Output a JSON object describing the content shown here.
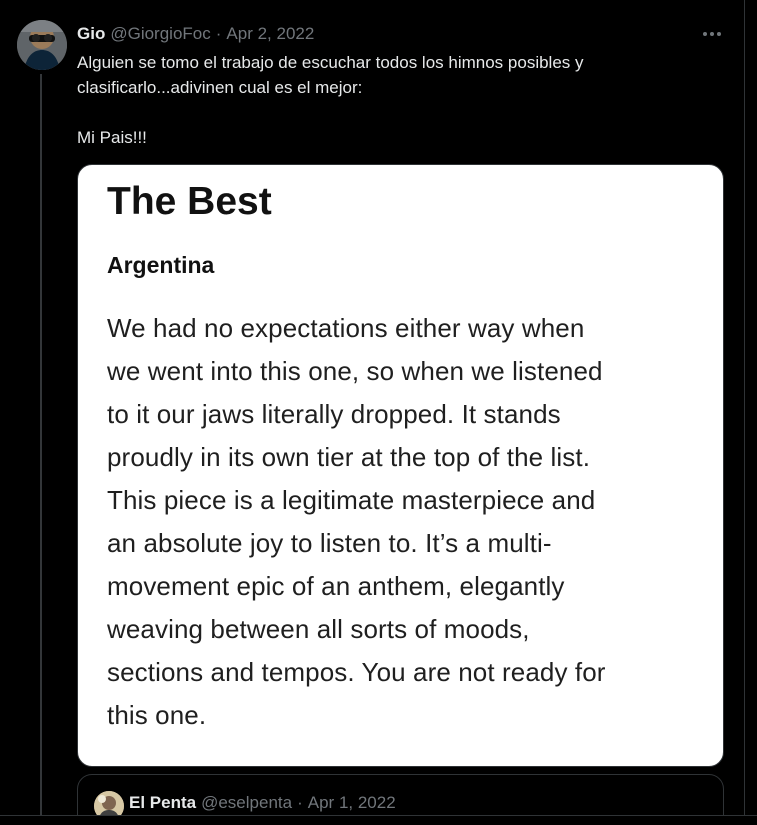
{
  "tweet": {
    "author_name": "Gio",
    "author_handle": "@GiorgioFoc",
    "separator": "·",
    "date": "Apr 2, 2022",
    "more_icon": "more-horizontal-icon",
    "text_line_1": "Alguien se tomo el trabajo de escuchar todos los himnos posibles y",
    "text_line_2": "clasificarlo...adivinen cual es el mejor:",
    "text_line_3": "Mi Pais!!!"
  },
  "media": {
    "title": "The Best",
    "subtitle": "Argentina",
    "body_lines": [
      "We had no expectations either way when",
      "we went into this one, so when we listened",
      "to it our jaws literally dropped. It stands",
      "proudly in its own tier at the top of the list.",
      "This piece is a legitimate masterpiece and",
      "an absolute joy to listen to. It’s a multi-",
      "movement epic of an anthem, elegantly",
      "weaving between all sorts of moods,",
      "sections and tempos. You are not ready for",
      "this one."
    ]
  },
  "quoted_tweet": {
    "author_name": "El Penta",
    "author_handle": "@eselpenta",
    "separator": "·",
    "date": "Apr 1, 2022"
  },
  "colors": {
    "background": "#000000",
    "primary_text": "#e7e9ea",
    "secondary_text": "#71767b",
    "border": "#2f3336",
    "media_background": "#ffffff"
  }
}
